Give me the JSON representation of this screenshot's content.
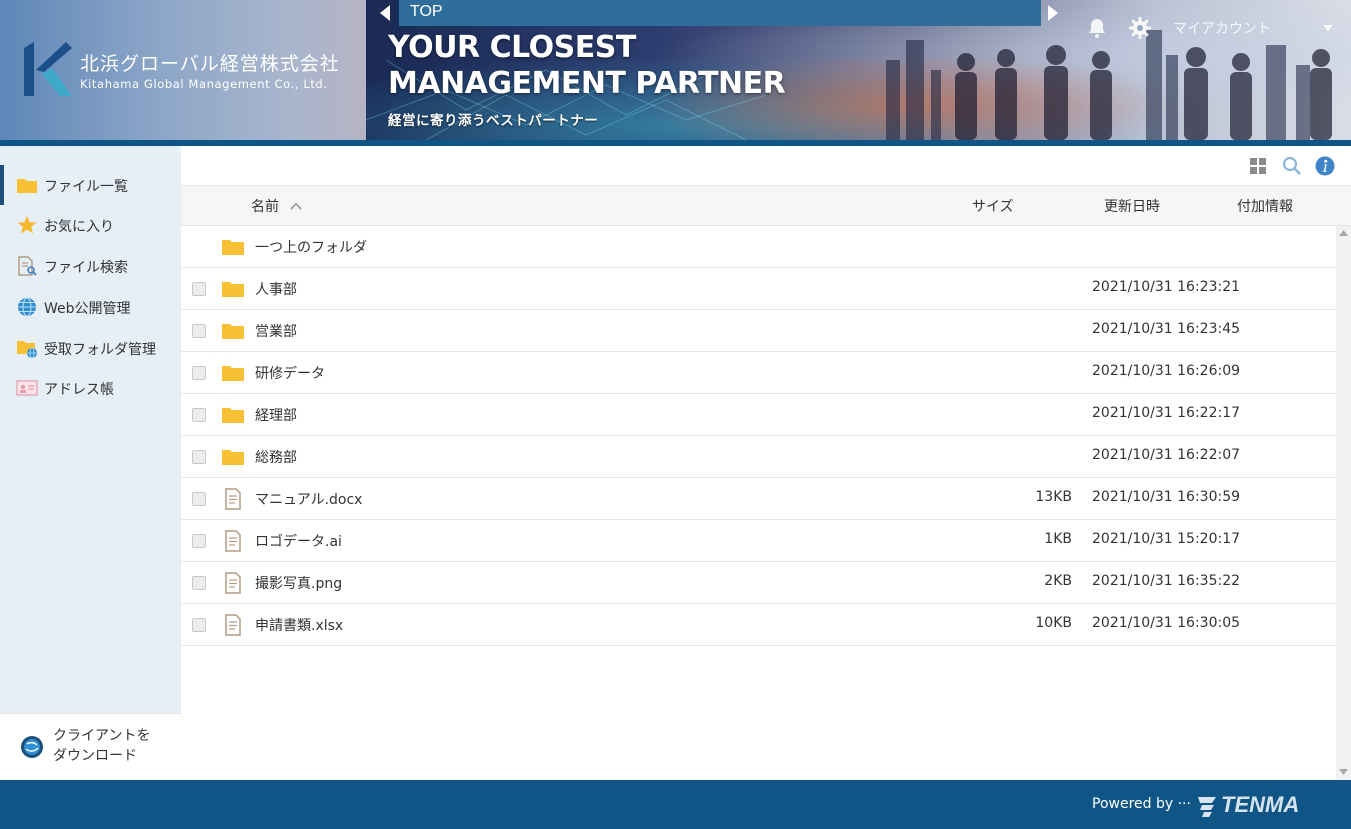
{
  "company": {
    "name_jp": "北浜グローバル経営株式会社",
    "name_en": "Kitahama Global Management Co., Ltd."
  },
  "banner": {
    "title": "YOUR CLOSEST\nMANAGEMENT PARTNER",
    "subtitle": "経営に寄り添うベストパートナー"
  },
  "breadcrumb": {
    "current": "TOP"
  },
  "header": {
    "account_label": "マイアカウント"
  },
  "sidebar": {
    "items": [
      {
        "label": "ファイル一覧",
        "icon": "folder-icon"
      },
      {
        "label": "お気に入り",
        "icon": "star-icon"
      },
      {
        "label": "ファイル検索",
        "icon": "file-search-icon"
      },
      {
        "label": "Web公開管理",
        "icon": "globe-icon"
      },
      {
        "label": "受取フォルダ管理",
        "icon": "folder-globe-icon"
      },
      {
        "label": "アドレス帳",
        "icon": "address-card-icon"
      }
    ],
    "download_label": "クライアントを\nダウンロード"
  },
  "table": {
    "columns": {
      "name": "名前",
      "size": "サイズ",
      "updated": "更新日時",
      "info": "付加情報"
    },
    "parent_folder": "一つ上のフォルダ",
    "rows": [
      {
        "name": "人事部",
        "type": "folder",
        "size": "",
        "updated": "2021/10/31 16:23:21"
      },
      {
        "name": "営業部",
        "type": "folder",
        "size": "",
        "updated": "2021/10/31 16:23:45"
      },
      {
        "name": "研修データ",
        "type": "folder",
        "size": "",
        "updated": "2021/10/31 16:26:09"
      },
      {
        "name": "経理部",
        "type": "folder",
        "size": "",
        "updated": "2021/10/31 16:22:17"
      },
      {
        "name": "総務部",
        "type": "folder",
        "size": "",
        "updated": "2021/10/31 16:22:07"
      },
      {
        "name": "マニュアル.docx",
        "type": "file",
        "size": "13KB",
        "updated": "2021/10/31 16:30:59"
      },
      {
        "name": "ロゴデータ.ai",
        "type": "file",
        "size": "1KB",
        "updated": "2021/10/31 15:20:17"
      },
      {
        "name": "撮影写真.png",
        "type": "file",
        "size": "2KB",
        "updated": "2021/10/31 16:35:22"
      },
      {
        "name": "申請書類.xlsx",
        "type": "file",
        "size": "10KB",
        "updated": "2021/10/31 16:30:05"
      }
    ]
  },
  "footer": {
    "powered_by": "Powered by ···",
    "brand": "TENMA"
  },
  "colors": {
    "header_blue": "#0f5585",
    "breadcrumb_blue": "#2f6d9a",
    "sidebar_bg": "#e6eef6",
    "folder_yellow": "#f8c034",
    "info_blue": "#3f84c8"
  }
}
